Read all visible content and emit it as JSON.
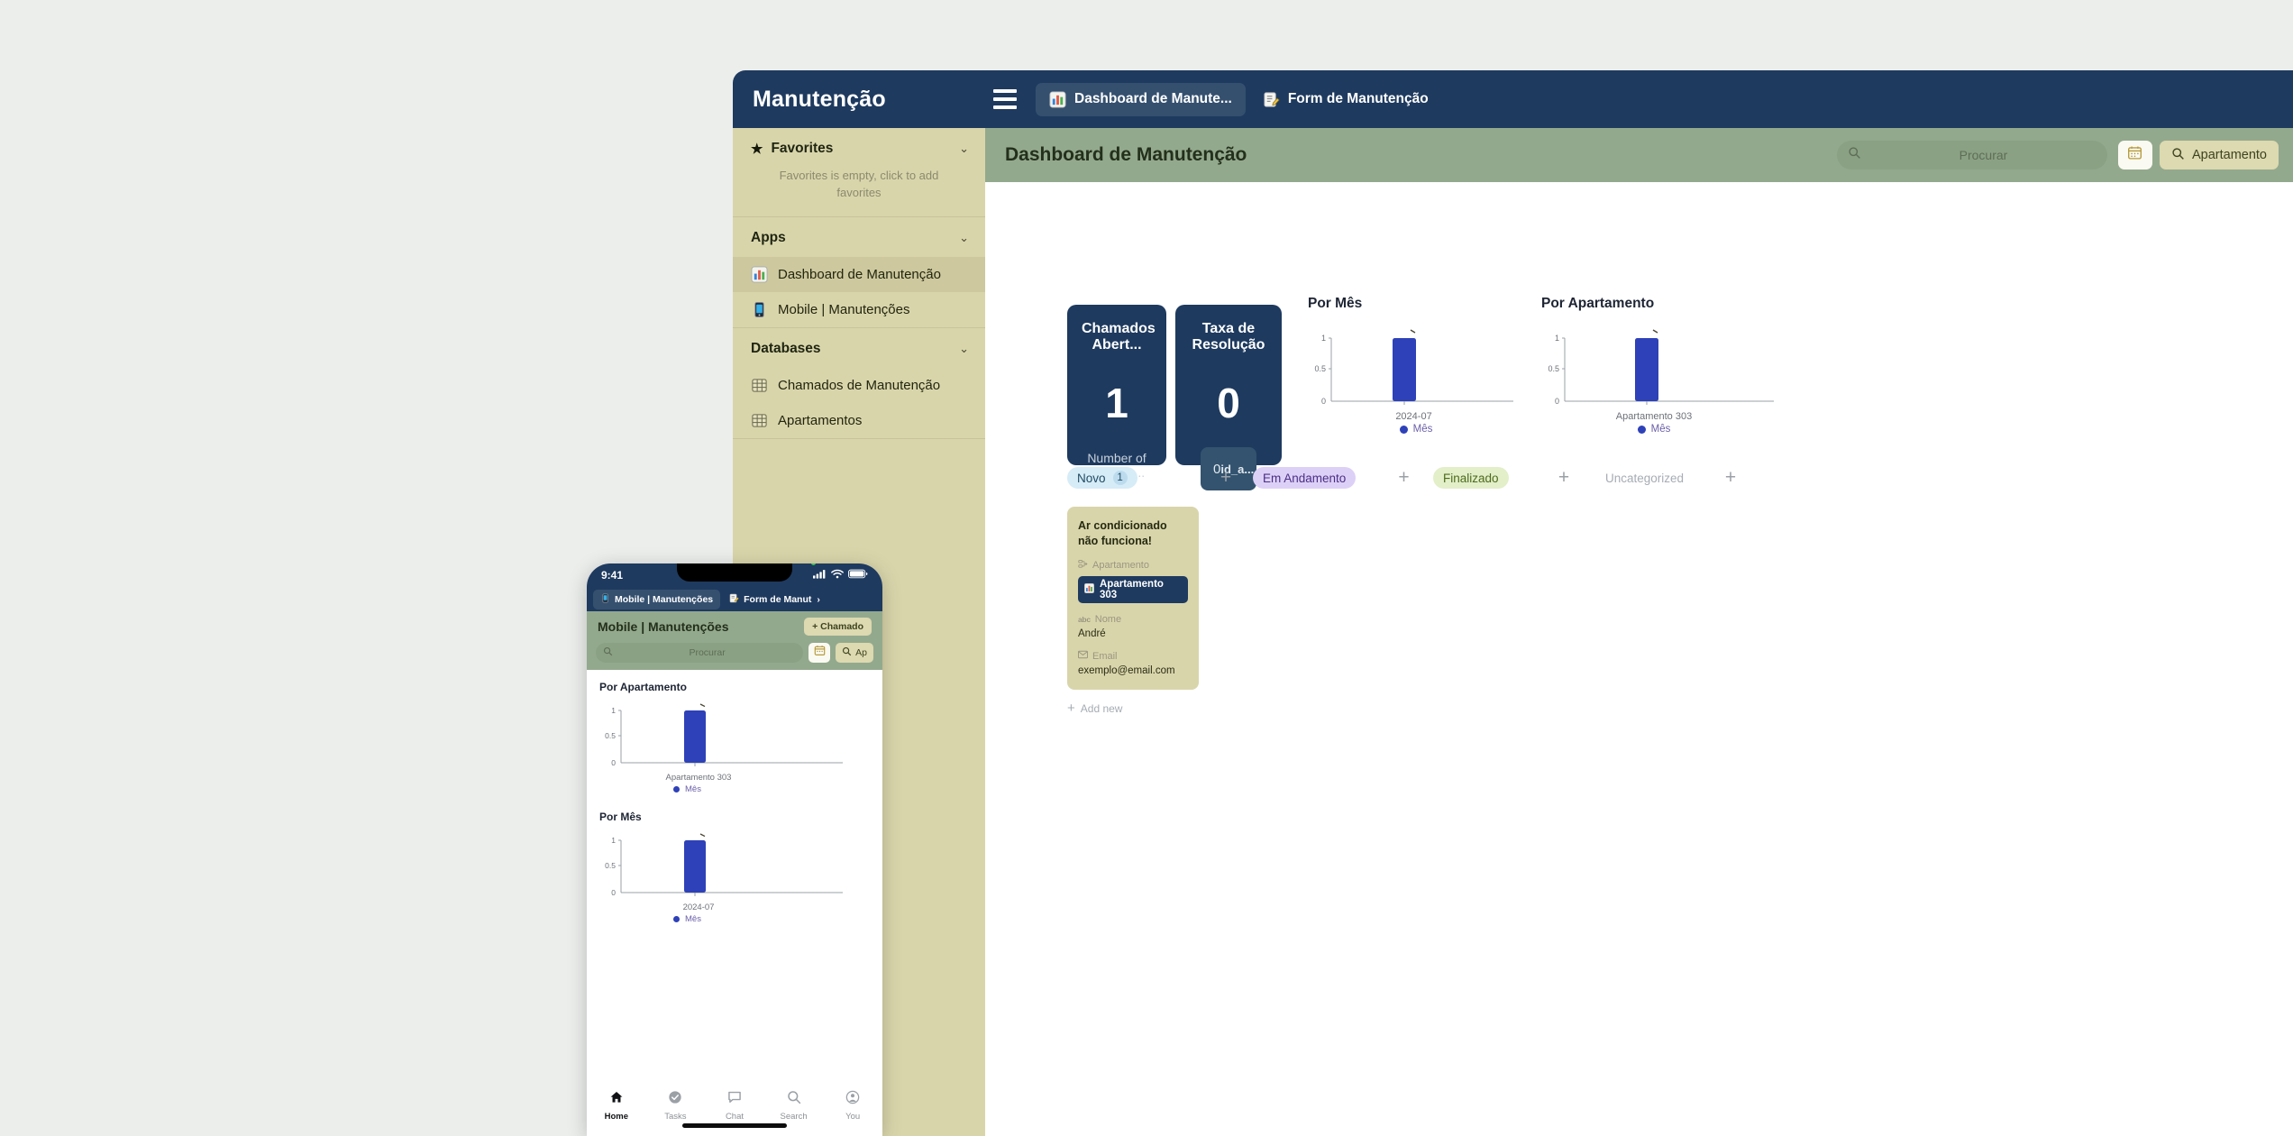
{
  "topbar": {
    "brand": "Manutenção",
    "menu_icon": "hamburger-icon",
    "tabs": [
      {
        "label": "Dashboard de Manute...",
        "icon": "bar-chart-icon",
        "active": true
      },
      {
        "label": "Form de Manutenção",
        "icon": "form-note-icon",
        "active": false
      }
    ]
  },
  "sidebar": {
    "favorites": {
      "label": "Favorites",
      "icon": "star-icon",
      "chevron": "chevron-down-icon",
      "empty_text": "Favorites is empty, click to add favorites"
    },
    "apps": {
      "label": "Apps",
      "chevron": "chevron-down-icon",
      "items": [
        {
          "label": "Dashboard de Manutenção",
          "icon": "bar-chart-icon",
          "selected": true
        },
        {
          "label": "Mobile | Manutenções",
          "icon": "mobile-phone-icon",
          "selected": false
        }
      ]
    },
    "databases": {
      "label": "Databases",
      "chevron": "chevron-down-icon",
      "items": [
        {
          "label": "Chamados de Manutenção",
          "icon": "table-icon",
          "selected": false
        },
        {
          "label": "Apartamentos",
          "icon": "table-icon",
          "selected": false
        }
      ]
    }
  },
  "page_header": {
    "title": "Dashboard de Manutenção",
    "search_placeholder": "Procurar",
    "search_icon": "search-icon",
    "calendar_button_icon": "calendar-icon",
    "filter_label": "Apartamento",
    "filter_icon": "search-icon"
  },
  "kpis": [
    {
      "title": "Chamados Abert...",
      "value": "1",
      "subtitle": "Number of records ..."
    },
    {
      "title": "Taxa de Resolução",
      "value": "0",
      "chip_value": "0",
      "chip_label": "id_a..."
    }
  ],
  "charts": [
    {
      "id": "por-mes",
      "title": "Por Mês",
      "legend": "Mês",
      "chart_data": {
        "type": "bar",
        "title": "Por Mês",
        "categories": [
          "2024-07"
        ],
        "values": [
          1
        ],
        "series": [
          {
            "name": "Mês",
            "values": [
              1
            ]
          }
        ],
        "xlabel": "",
        "ylabel": "",
        "ylim": [
          0,
          1
        ],
        "yticks": [
          "0",
          "0.5",
          "1"
        ],
        "grid": false,
        "legend_position": "bottom",
        "bar_color": "#2e41b8"
      }
    },
    {
      "id": "por-apartamento",
      "title": "Por Apartamento",
      "legend": "Mês",
      "chart_data": {
        "type": "bar",
        "title": "Por Apartamento",
        "categories": [
          "Apartamento 303"
        ],
        "values": [
          1
        ],
        "series": [
          {
            "name": "Mês",
            "values": [
              1
            ]
          }
        ],
        "xlabel": "",
        "ylabel": "",
        "ylim": [
          0,
          1
        ],
        "yticks": [
          "0",
          "0.5",
          "1"
        ],
        "grid": false,
        "legend_position": "bottom",
        "bar_color": "#2e41b8"
      }
    }
  ],
  "kanban": {
    "columns": [
      {
        "label": "Novo",
        "count": "1",
        "bg": "#d6ecf7",
        "fg": "#1f4a63",
        "count_bg": "#bcdcee"
      },
      {
        "label": "Em Andamento",
        "count": "",
        "bg": "#ddd0f7",
        "fg": "#4a2f84",
        "count_bg": ""
      },
      {
        "label": "Finalizado",
        "count": "",
        "bg": "#e2efc9",
        "fg": "#4d6a1d",
        "count_bg": ""
      },
      {
        "label": "Uncategorized",
        "count": "",
        "bg": "transparent",
        "fg": "#a6acb3",
        "count_bg": ""
      }
    ],
    "add_column_icon": "plus-icon",
    "card": {
      "title": "Ar condicionado não funciona!",
      "fields": [
        {
          "label": "Apartamento",
          "icon": "relation-icon",
          "value": "Apartamento 303",
          "type": "reference",
          "value_icon": "bar-chart-icon"
        },
        {
          "label": "Nome",
          "icon": "abc-icon",
          "value": "André",
          "type": "text"
        },
        {
          "label": "Email",
          "icon": "envelope-icon",
          "value": "exemplo@email.com",
          "type": "text"
        }
      ]
    },
    "add_new_label": "Add new",
    "add_new_icon": "plus-icon"
  },
  "phone": {
    "status": {
      "time": "9:41",
      "cellular_icon": "signal-bars-icon",
      "wifi_icon": "wifi-icon",
      "battery_icon": "battery-icon"
    },
    "tabs": [
      {
        "label": "Mobile | Manutenções",
        "icon": "mobile-phone-icon",
        "active": true
      },
      {
        "label": "Form de Manut",
        "icon": "form-note-icon",
        "active": false
      }
    ],
    "header": {
      "title": "Mobile | Manutenções",
      "new_button": "+ Chamado"
    },
    "search": {
      "placeholder": "Procurar",
      "search_icon": "search-icon",
      "calendar_button_icon": "calendar-icon",
      "filter_label": "Ap",
      "filter_icon": "search-icon"
    },
    "charts": [
      {
        "id": "m-por-apartamento",
        "title": "Por Apartamento",
        "legend": "Mês",
        "chart_data": {
          "type": "bar",
          "title": "Por Apartamento",
          "categories": [
            "Apartamento 303"
          ],
          "values": [
            1
          ],
          "series": [
            {
              "name": "Mês",
              "values": [
                1
              ]
            }
          ],
          "ylim": [
            0,
            1
          ],
          "yticks": [
            "0",
            "0.5",
            "1"
          ],
          "grid": false,
          "legend_position": "bottom",
          "bar_color": "#2e41b8"
        }
      },
      {
        "id": "m-por-mes",
        "title": "Por Mês",
        "legend": "Mês",
        "chart_data": {
          "type": "bar",
          "title": "Por Mês",
          "categories": [
            "2024-07"
          ],
          "values": [
            1
          ],
          "series": [
            {
              "name": "Mês",
              "values": [
                1
              ]
            }
          ],
          "ylim": [
            0,
            1
          ],
          "yticks": [
            "0",
            "0.5",
            "1"
          ],
          "grid": false,
          "legend_position": "bottom",
          "bar_color": "#2e41b8"
        }
      }
    ],
    "nav": [
      {
        "label": "Home",
        "icon": "home-icon",
        "active": true
      },
      {
        "label": "Tasks",
        "icon": "check-circle-icon",
        "active": false
      },
      {
        "label": "Chat",
        "icon": "chat-bubble-icon",
        "active": false
      },
      {
        "label": "Search",
        "icon": "search-icon",
        "active": false
      },
      {
        "label": "You",
        "icon": "person-circle-icon",
        "active": false
      }
    ]
  },
  "theme": {
    "navy": "#1e3a5f",
    "sidebar_tan": "#d9d5ab",
    "header_green": "#93a98d",
    "bar_blue": "#2e41b8",
    "page_bg": "#eceeec"
  }
}
